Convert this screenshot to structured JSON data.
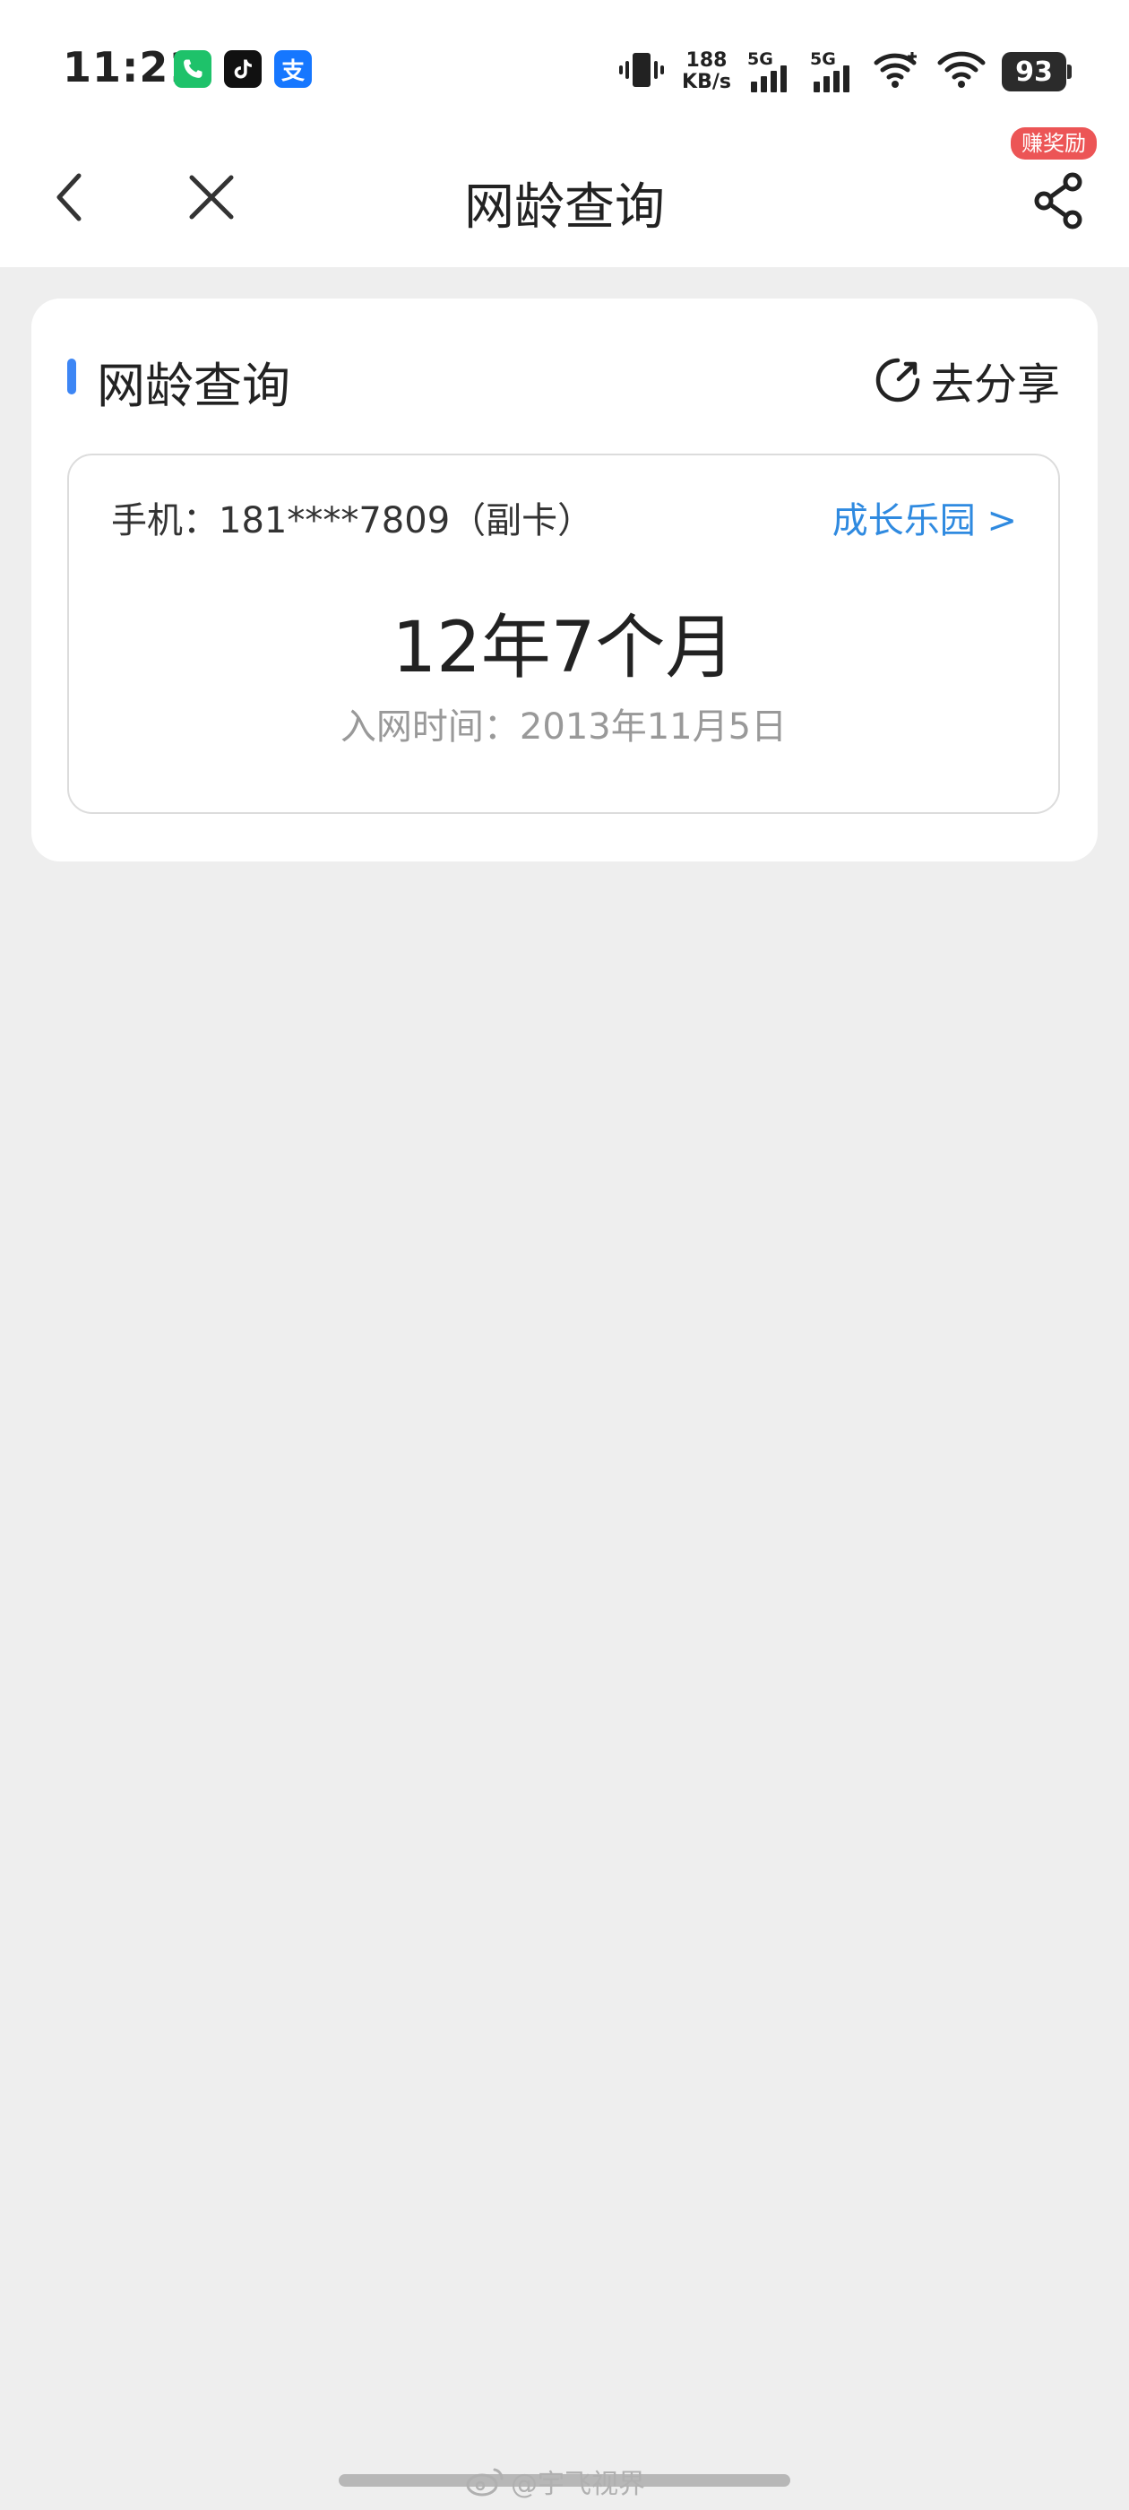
{
  "status_bar": {
    "time": "11:21",
    "net_speed_value": "188",
    "net_speed_unit": "KB/s",
    "sim1_tag": "5G",
    "sim2_tag": "5G",
    "battery": "93",
    "apps": [
      {
        "icon": "call-app-icon",
        "glyph": "",
        "color": "#1ec26a"
      },
      {
        "icon": "tiktok-icon",
        "glyph": "",
        "color": "#111111"
      },
      {
        "icon": "alipay-icon",
        "glyph": "支",
        "color": "#1677ff"
      }
    ]
  },
  "nav": {
    "title": "网龄查询",
    "reward_badge": "赚奖励"
  },
  "card": {
    "section_title": "网龄查询",
    "share_label": "去分享",
    "phone_label": "手机：181****7809（副卡）",
    "growth_link": "成长乐园 >",
    "age_value": "12年7个月",
    "join_date": "入网时间：2013年11月5日"
  },
  "watermark": "@宇飞视界",
  "colors": {
    "accent_blue": "#3d86f5",
    "link_blue": "#2f8ae0",
    "badge_red": "#ec5556",
    "page_bg": "#eeeeee"
  }
}
